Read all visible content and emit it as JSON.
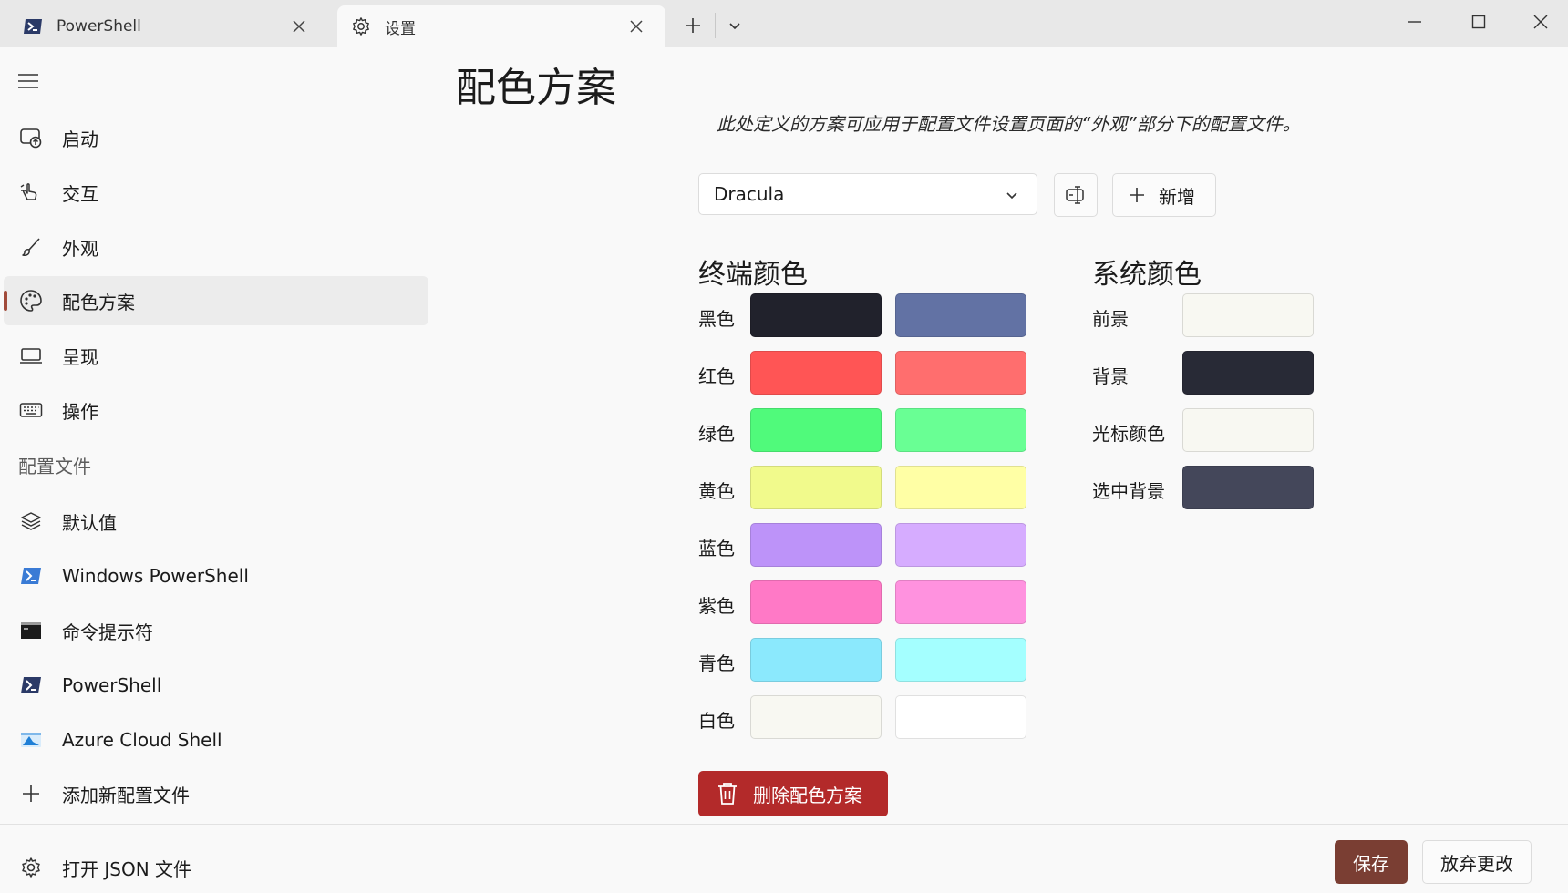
{
  "tabs": [
    {
      "label": "PowerShell",
      "icon": "powershell-icon"
    },
    {
      "label": "设置",
      "icon": "gear-icon"
    }
  ],
  "sidebar": {
    "items": [
      {
        "label": "启动",
        "icon": "startup-icon"
      },
      {
        "label": "交互",
        "icon": "interaction-icon"
      },
      {
        "label": "外观",
        "icon": "brush-icon"
      },
      {
        "label": "配色方案",
        "icon": "palette-icon",
        "selected": true
      },
      {
        "label": "呈现",
        "icon": "monitor-icon"
      },
      {
        "label": "操作",
        "icon": "keyboard-icon"
      }
    ],
    "profiles_header": "配置文件",
    "profiles": [
      {
        "label": "默认值",
        "icon": "layers-icon"
      },
      {
        "label": "Windows PowerShell",
        "icon": "powershell-icon"
      },
      {
        "label": "命令提示符",
        "icon": "cmd-icon"
      },
      {
        "label": "PowerShell",
        "icon": "powershell-icon"
      },
      {
        "label": "Azure Cloud Shell",
        "icon": "azure-icon"
      },
      {
        "label": "添加新配置文件",
        "icon": "plus-icon"
      }
    ],
    "open_json": {
      "label": "打开 JSON 文件",
      "icon": "gear-icon"
    }
  },
  "main": {
    "title": "配色方案",
    "subtitle": "此处定义的方案可应用于配置文件设置页面的“外观”部分下的配置文件。",
    "selected_scheme": "Dracula",
    "new_button": "新增",
    "terminal_colors_title": "终端颜色",
    "system_colors_title": "系统颜色",
    "terminal_colors": [
      {
        "label": "黑色",
        "normal": "#21222c",
        "bright": "#6272a4"
      },
      {
        "label": "红色",
        "normal": "#ff5555",
        "bright": "#ff6e6e"
      },
      {
        "label": "绿色",
        "normal": "#50fa7b",
        "bright": "#69ff94"
      },
      {
        "label": "黄色",
        "normal": "#f1fa8c",
        "bright": "#ffffa5"
      },
      {
        "label": "蓝色",
        "normal": "#bd93f9",
        "bright": "#d6acff"
      },
      {
        "label": "紫色",
        "normal": "#ff79c6",
        "bright": "#ff92df"
      },
      {
        "label": "青色",
        "normal": "#8be9fd",
        "bright": "#a4ffff"
      },
      {
        "label": "白色",
        "normal": "#f8f8f2",
        "bright": "#ffffff"
      }
    ],
    "system_colors": [
      {
        "label": "前景",
        "color": "#f8f8f2"
      },
      {
        "label": "背景",
        "color": "#282a36"
      },
      {
        "label": "光标颜色",
        "color": "#f8f8f2"
      },
      {
        "label": "选中背景",
        "color": "#44475a"
      }
    ],
    "delete_button": "删除配色方案"
  },
  "footer": {
    "save": "保存",
    "discard": "放弃更改"
  },
  "colors": {
    "accent": "#7a3e33",
    "selection_indicator": "#a14b3b",
    "danger": "#b32a2a"
  }
}
